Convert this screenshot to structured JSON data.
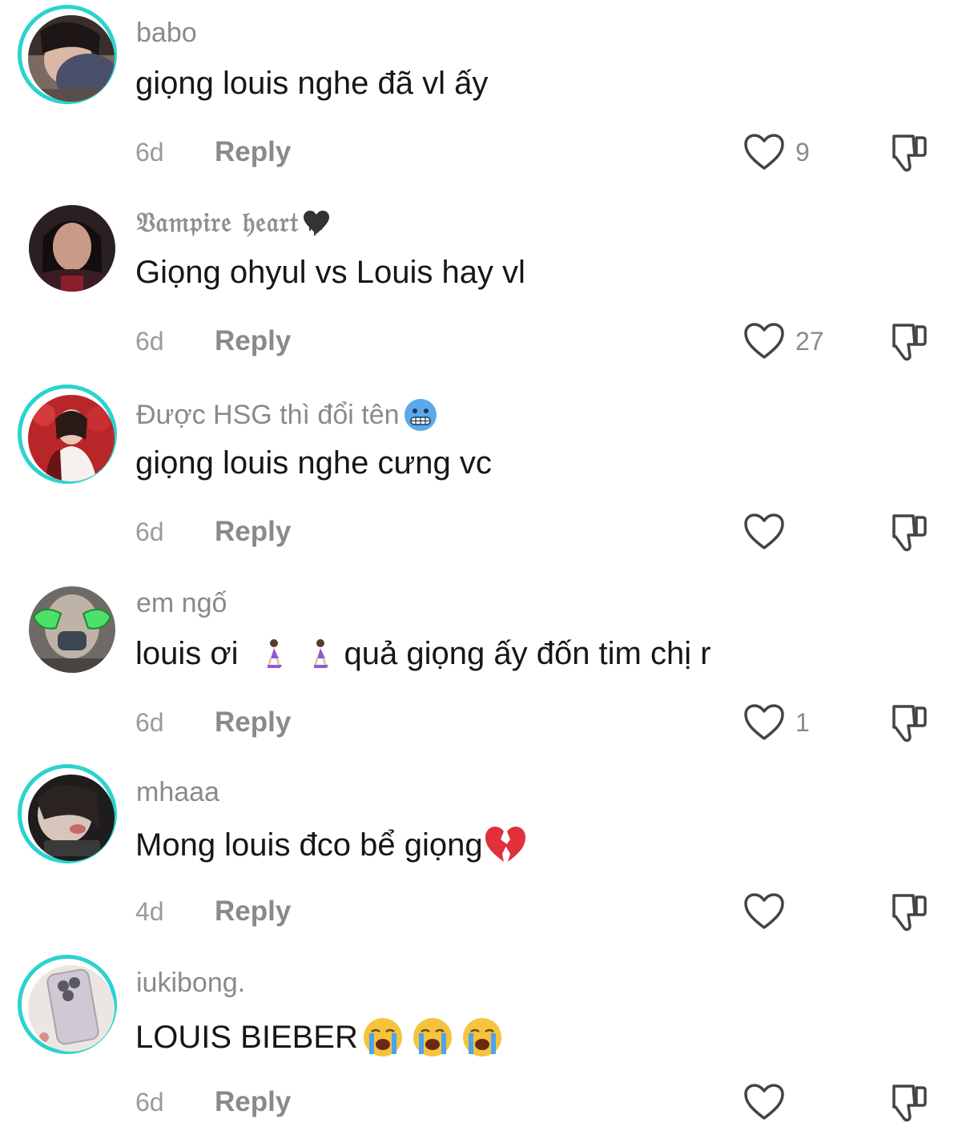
{
  "comments": [
    {
      "username": "babo",
      "text": "giọng louis nghe đã vl ấy",
      "time": "6d",
      "reply": "Reply",
      "likes": "9",
      "ring": true
    },
    {
      "username": "𝔙𝔞𝔪𝔭𝔦𝔯𝔢 𝔥𝔢𝔞𝔯𝔱",
      "text": "Giọng ohyul vs Louis hay vl",
      "time": "6d",
      "reply": "Reply",
      "likes": "27",
      "ring": false
    },
    {
      "username": "Được HSG thì đổi tên",
      "text": "giọng louis nghe cưng vc",
      "time": "6d",
      "reply": "Reply",
      "likes": "",
      "ring": true
    },
    {
      "username": "em ngố",
      "text_a": "louis ơi",
      "text_b": "quả giọng ấy đốn tim chị r",
      "time": "6d",
      "reply": "Reply",
      "likes": "1",
      "ring": false
    },
    {
      "username": "mhaaa",
      "text": "Mong louis đco bể giọng",
      "time": "4d",
      "reply": "Reply",
      "likes": "",
      "ring": true
    },
    {
      "username": "iukibong.",
      "text": "LOUIS BIEBER",
      "time": "6d",
      "reply": "Reply",
      "likes": "",
      "ring": true
    }
  ],
  "colors": {
    "ring": "#2bd3cf",
    "text": "#161616",
    "muted": "#8a8a8a"
  },
  "icons": [
    "heart-icon",
    "dislike-icon",
    "freezing-face-emoji",
    "kneeling-woman-emoji",
    "broken-heart-emoji",
    "crying-face-emoji"
  ]
}
